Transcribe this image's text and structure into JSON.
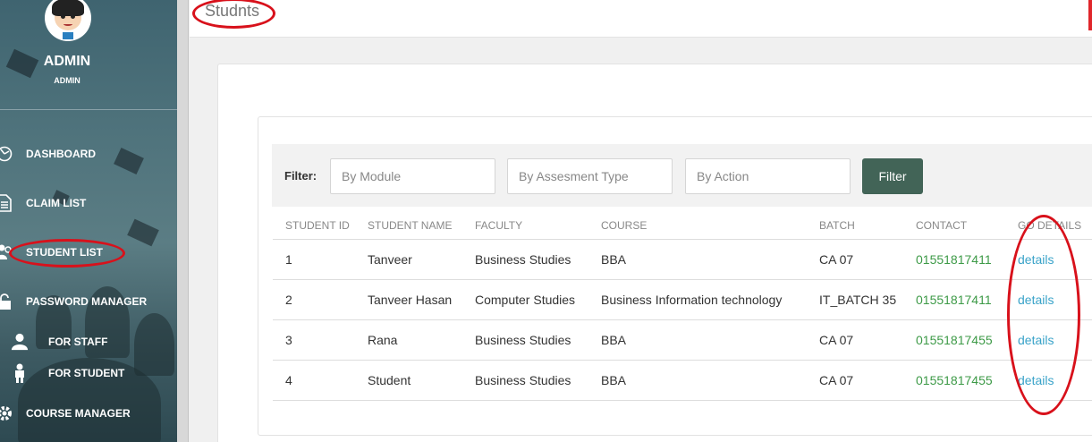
{
  "sidebar": {
    "user_name": "ADMIN",
    "user_role": "ADMIN",
    "items": [
      {
        "label": "DASHBOARD",
        "icon": "dashboard-icon"
      },
      {
        "label": "CLAIM LIST",
        "icon": "document-icon"
      },
      {
        "label": "STUDENT LIST",
        "icon": "users-icon"
      },
      {
        "label": "PASSWORD MANAGER",
        "icon": "lock-icon"
      },
      {
        "label": "FOR STAFF",
        "icon": "user-icon"
      },
      {
        "label": "FOR STUDENT",
        "icon": "student-icon"
      },
      {
        "label": "COURSE MANAGER",
        "icon": "gear-icon"
      }
    ]
  },
  "header": {
    "title": "Studnts"
  },
  "filter": {
    "label": "Filter:",
    "module_placeholder": "By Module",
    "assessment_placeholder": "By Assesment Type",
    "action_placeholder": "By Action",
    "button_label": "Filter"
  },
  "table": {
    "columns": [
      "STUDENT ID",
      "STUDENT NAME",
      "FACULTY",
      "COURSE",
      "BATCH",
      "CONTACT",
      "GO DETAILS"
    ],
    "rows": [
      {
        "id": "1",
        "name": "Tanveer",
        "faculty": "Business Studies",
        "course": "BBA",
        "batch": "CA 07",
        "contact": "01551817411",
        "details": "details"
      },
      {
        "id": "2",
        "name": "Tanveer Hasan",
        "faculty": "Computer Studies",
        "course": "Business Information technology",
        "batch": "IT_BATCH 35",
        "contact": "01551817411",
        "details": "details"
      },
      {
        "id": "3",
        "name": "Rana",
        "faculty": "Business Studies",
        "course": "BBA",
        "batch": "CA 07",
        "contact": "01551817455",
        "details": "details"
      },
      {
        "id": "4",
        "name": "Student",
        "faculty": "Business Studies",
        "course": "BBA",
        "batch": "CA 07",
        "contact": "01551817455",
        "details": "details"
      }
    ]
  },
  "colors": {
    "sidebar": "#4f737c",
    "filter_button": "#426457",
    "contact_text": "#3d9a47",
    "link": "#3aa3c9",
    "annotation": "#d8111b"
  }
}
